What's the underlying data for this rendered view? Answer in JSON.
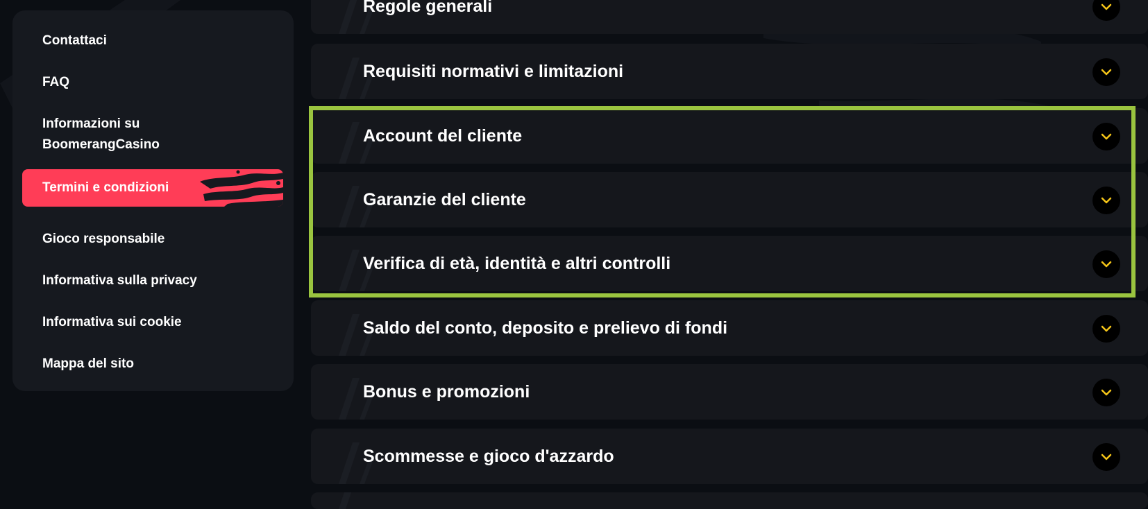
{
  "sidebar": {
    "items": [
      {
        "label": "Contattaci",
        "active": false
      },
      {
        "label": "FAQ",
        "active": false
      },
      {
        "label": "Informazioni su BoomerangCasino",
        "active": false
      },
      {
        "label": "Termini e condizioni",
        "active": true
      },
      {
        "label": "Gioco responsabile",
        "active": false
      },
      {
        "label": "Informativa sulla privacy",
        "active": false
      },
      {
        "label": "Informativa sui cookie",
        "active": false
      },
      {
        "label": "Mappa del sito",
        "active": false
      }
    ]
  },
  "accordion": {
    "items": [
      {
        "title": "Regole generali",
        "icon": "chevron-down-icon"
      },
      {
        "title": "Requisiti normativi e limitazioni",
        "icon": "chevron-down-icon"
      },
      {
        "title": "Account del cliente",
        "icon": "chevron-down-icon"
      },
      {
        "title": "Garanzie del cliente",
        "icon": "chevron-down-icon"
      },
      {
        "title": "Verifica di età, identità e altri controlli",
        "icon": "chevron-down-icon"
      },
      {
        "title": "Saldo del conto, deposito e prelievo di fondi",
        "icon": "chevron-down-icon"
      },
      {
        "title": "Bonus e promozioni",
        "icon": "chevron-down-icon"
      },
      {
        "title": "Scommesse e gioco d'azzardo",
        "icon": "chevron-down-icon"
      }
    ]
  },
  "colors": {
    "accent": "#ff3d57",
    "chevron": "#f5c518",
    "highlight": "#9ac43f",
    "panel": "#15171c",
    "background": "#0b0e13"
  }
}
